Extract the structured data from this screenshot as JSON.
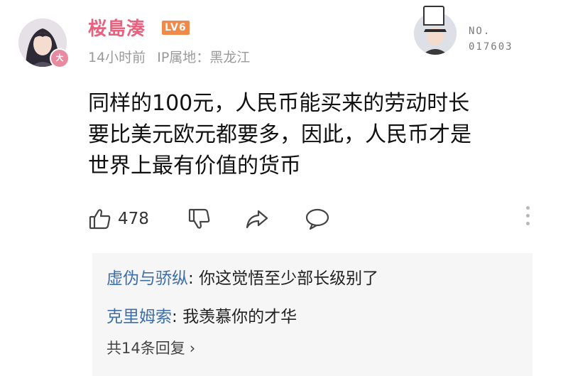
{
  "comment": {
    "username": "桜島湊",
    "level": "LV6",
    "avatar_badge": "大",
    "time": "14小时前",
    "ip_location": "IP属地：黑龙江",
    "content_lines": [
      "同样的100元，人民币能买来的劳动时长",
      "要比美元欧元都要多，因此，人民币才是",
      "世界上最有价值的货币"
    ],
    "like_count": "478"
  },
  "fan_card": {
    "label": "NO.",
    "number": "017603"
  },
  "replies": {
    "items": [
      {
        "name": "虚伪与骄纵",
        "sep": ": ",
        "text": "你这觉悟至少部长级别了"
      },
      {
        "name": "克里姆索",
        "sep": ": ",
        "text": "我羡慕你的才华"
      }
    ],
    "total_label": "共14条回复",
    "chevron": "›"
  },
  "colors": {
    "username": "#e8617e",
    "level_badge": "#ef8a4a",
    "reply_name": "#3f6fa8",
    "reply_bg": "#f6f6f6"
  },
  "icons": [
    "thumbs-up-icon",
    "thumbs-down-icon",
    "share-icon",
    "comment-icon",
    "more-icon"
  ]
}
